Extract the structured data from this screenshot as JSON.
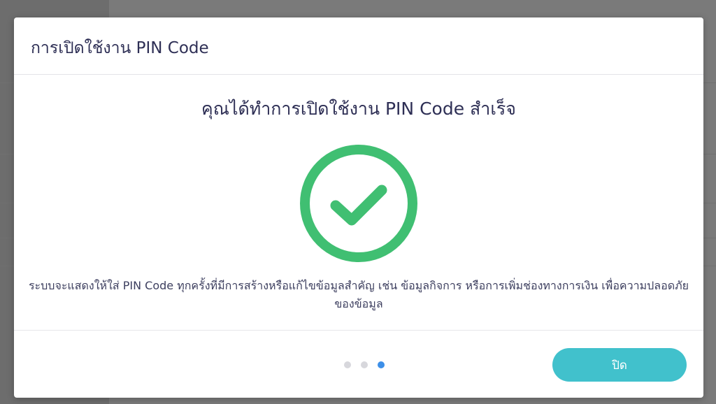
{
  "modal": {
    "title": "การเปิดใช้งาน PIN Code",
    "success_heading": "คุณได้ทำการเปิดใช้งาน PIN Code สำเร็จ",
    "description": "ระบบจะแสดงให้ใส่ PIN Code ทุกครั้งที่มีการสร้างหรือแก้ไขข้อมูลสำคัญ เช่น ข้อมูลกิจการ หรือการเพิ่มช่องทางการเงิน เพื่อความปลอดภัยของข้อมูล",
    "close_label": "ปิด",
    "status_icon": "check-circle-icon",
    "step_indicator": {
      "total": 3,
      "current": 3
    }
  },
  "colors": {
    "success_green": "#40bf72",
    "accent_teal": "#41c1cc",
    "active_dot": "#3d8fe8",
    "title_text": "#2e2f55"
  }
}
